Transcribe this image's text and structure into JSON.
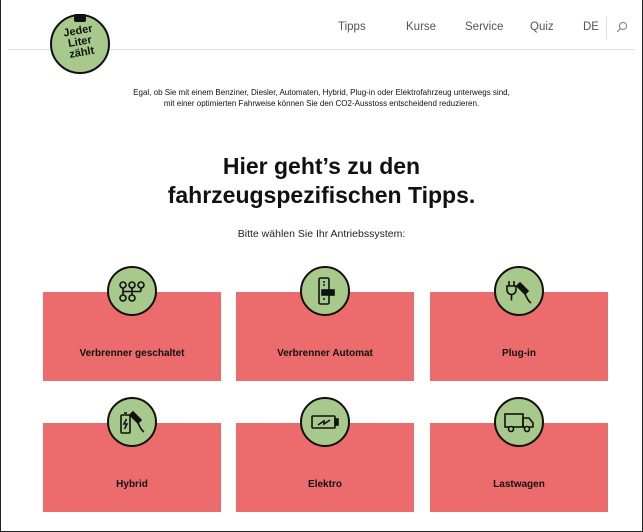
{
  "logo": {
    "lines": [
      "Jeder",
      "Liter",
      "zählt"
    ]
  },
  "nav": {
    "items": [
      {
        "label": "Tipps"
      },
      {
        "label": "Kurse"
      },
      {
        "label": "Service"
      },
      {
        "label": "Quiz"
      },
      {
        "label": "DE"
      }
    ],
    "search_icon": "search-icon"
  },
  "intro": {
    "text": "Egal, ob Sie mit einem Benziner, Diesler, Automaten, Hybrid, Plug-in oder Elektrofahrzeug unterwegs sind, mit einer optimierten Fahrweise können Sie den CO2-Ausstoss entscheidend reduzieren."
  },
  "headline": {
    "line1": "Hier geht’s zu den",
    "line2": "fahrzeugspezifischen Tipps."
  },
  "subline": "Bitte wählen Sie Ihr Antriebssystem:",
  "cards": [
    {
      "label": "Verbrenner geschaltet",
      "icon": "manual-gearbox-icon"
    },
    {
      "label": "Verbrenner Automat",
      "icon": "automatic-gear-lever-icon"
    },
    {
      "label": "Plug-in",
      "icon": "plug-icon"
    },
    {
      "label": "Hybrid",
      "icon": "battery-fuel-icon"
    },
    {
      "label": "Elektro",
      "icon": "electric-battery-icon"
    },
    {
      "label": "Lastwagen",
      "icon": "truck-icon"
    }
  ],
  "colors": {
    "card": "#ec6b6c",
    "icon_circle": "#a8c98c",
    "text": "#111111"
  }
}
